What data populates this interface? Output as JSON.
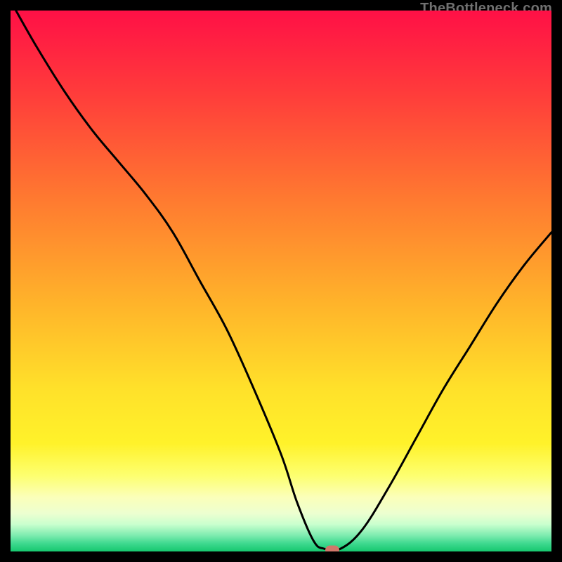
{
  "watermark": "TheBottleneck.com",
  "chart_data": {
    "type": "line",
    "title": "",
    "xlabel": "",
    "ylabel": "",
    "x_range": [
      0,
      100
    ],
    "y_range": [
      0,
      100
    ],
    "gradient_stops": [
      {
        "pct": 0,
        "color": "#ff1046"
      },
      {
        "pct": 15,
        "color": "#ff3b3b"
      },
      {
        "pct": 35,
        "color": "#ff7a30"
      },
      {
        "pct": 55,
        "color": "#ffb62a"
      },
      {
        "pct": 70,
        "color": "#ffe12a"
      },
      {
        "pct": 80,
        "color": "#fff22a"
      },
      {
        "pct": 86,
        "color": "#fdff70"
      },
      {
        "pct": 90,
        "color": "#fbffba"
      },
      {
        "pct": 93,
        "color": "#ecffd0"
      },
      {
        "pct": 95,
        "color": "#c9ffce"
      },
      {
        "pct": 97,
        "color": "#7fecb0"
      },
      {
        "pct": 98.5,
        "color": "#3fd98f"
      },
      {
        "pct": 100,
        "color": "#16c86f"
      }
    ],
    "series": [
      {
        "name": "bottleneck-curve",
        "color": "#000000",
        "stroke_width": 3,
        "x": [
          1,
          5,
          10,
          15,
          20,
          25,
          30,
          35,
          40,
          45,
          50,
          53,
          56,
          58,
          61,
          65,
          70,
          75,
          80,
          85,
          90,
          95,
          100
        ],
        "y": [
          100,
          93,
          85,
          78,
          72,
          66,
          59,
          50,
          41,
          30,
          18,
          9,
          2,
          0.5,
          0.5,
          4,
          12,
          21,
          30,
          38,
          46,
          53,
          59
        ]
      }
    ],
    "marker": {
      "x": 59.5,
      "y": 0.2,
      "color": "#d1776a"
    }
  }
}
